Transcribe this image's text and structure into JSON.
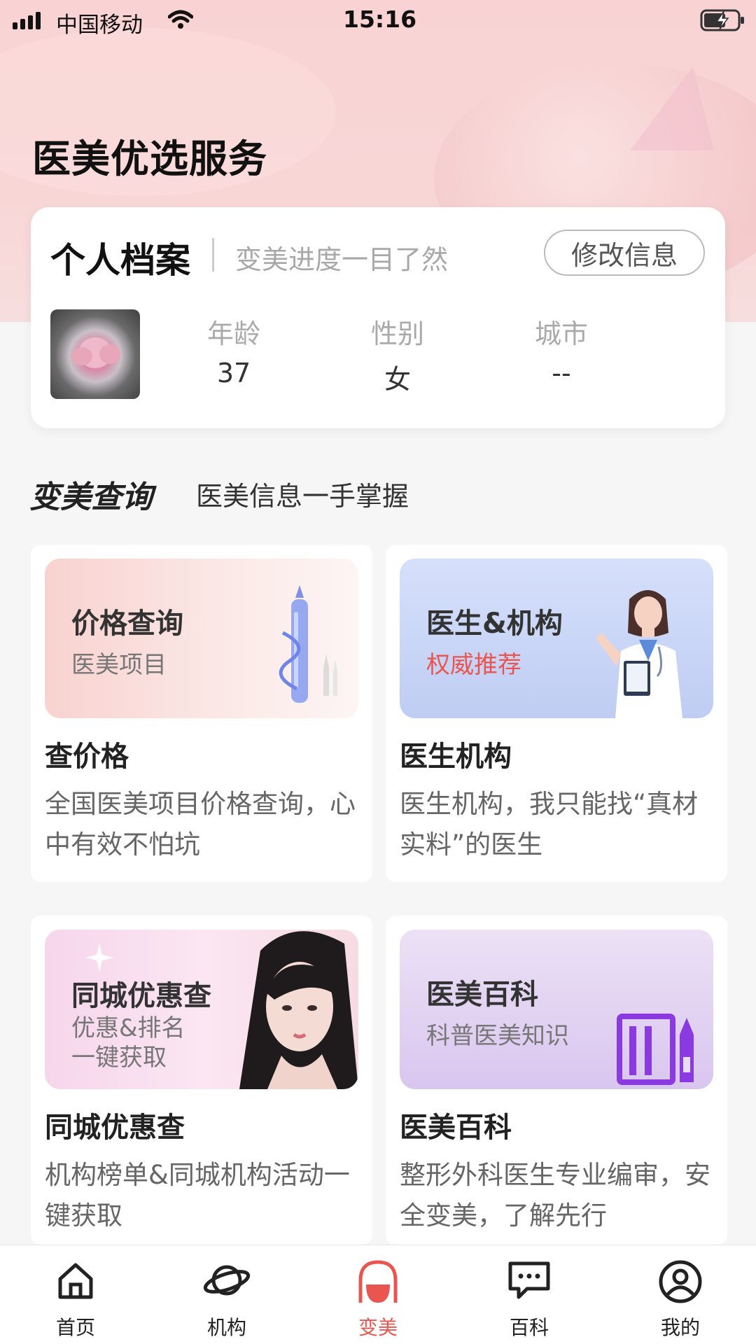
{
  "status_bar": {
    "carrier": "中国移动",
    "time": "15:16"
  },
  "page": {
    "title": "医美优选服务"
  },
  "profile": {
    "title": "个人档案",
    "subtitle": "变美进度一目了然",
    "edit_label": "修改信息",
    "age_label": "年龄",
    "age_value": "37",
    "gender_label": "性别",
    "gender_value": "女",
    "city_label": "城市",
    "city_value": "--"
  },
  "section": {
    "title": "变美查询",
    "subtitle": "医美信息一手掌握"
  },
  "cards": [
    {
      "banner_title": "价格查询",
      "banner_sub": "医美项目",
      "title": "查价格",
      "desc": "全国医美项目价格查询，心中有效不怕坑"
    },
    {
      "banner_title": "医生&机构",
      "banner_sub": "权威推荐",
      "title": "医生机构",
      "desc": "医生机构，我只能找“真材实料”的医生"
    },
    {
      "banner_title": "同城优惠查",
      "banner_sub": "优惠&排名",
      "banner_sub2": "一键获取",
      "title": "同城优惠查",
      "desc": "机构榜单&同城机构活动一键获取"
    },
    {
      "banner_title": "医美百科",
      "banner_sub": "科普医美知识",
      "title": "医美百科",
      "desc": "整形外科医生专业编审，安全变美，了解先行"
    }
  ],
  "tabbar": {
    "items": [
      {
        "label": "首页",
        "icon": "home-icon"
      },
      {
        "label": "机构",
        "icon": "planet-icon"
      },
      {
        "label": "变美",
        "icon": "beauty-icon"
      },
      {
        "label": "百科",
        "icon": "chat-icon"
      },
      {
        "label": "我的",
        "icon": "user-icon"
      }
    ],
    "active_index": 2
  },
  "colors": {
    "accent": "#e9564f",
    "hero_bg": "#f9d3d4"
  }
}
